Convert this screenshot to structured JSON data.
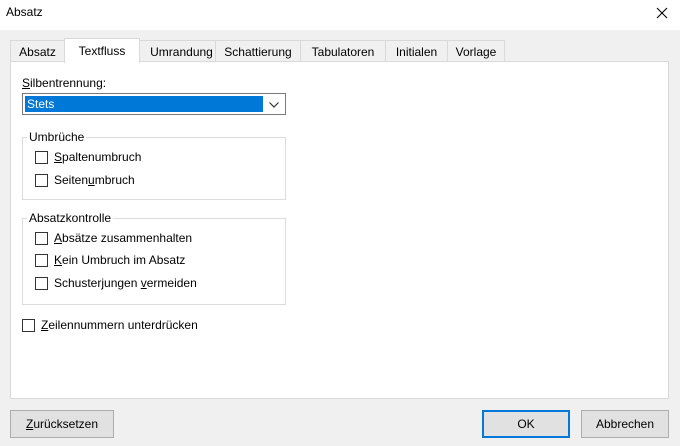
{
  "window": {
    "title": "Absatz",
    "close_icon": "close-icon"
  },
  "tabs": [
    {
      "label": "Absatz",
      "active": false
    },
    {
      "label": "Textfluss",
      "active": true
    },
    {
      "label": "Umrandung",
      "active": false
    },
    {
      "label": "Schattierung",
      "active": false
    },
    {
      "label": "Tabulatoren",
      "active": false
    },
    {
      "label": "Initialen",
      "active": false
    },
    {
      "label": "Vorlage",
      "active": false
    }
  ],
  "hyphenation": {
    "label_mnemonic": "S",
    "label_rest": "ilbentrennung:",
    "selected": "Stets",
    "dropdown_icon": "chevron-down-icon"
  },
  "breaks": {
    "title": "Umbrüche",
    "items": [
      {
        "pre": "",
        "mnemonic": "S",
        "post": "paltenumbruch",
        "checked": false
      },
      {
        "pre": "Seiten",
        "mnemonic": "u",
        "post": "mbruch",
        "checked": false
      }
    ]
  },
  "paragraph_control": {
    "title": "Absatzkontrolle",
    "items": [
      {
        "pre": "",
        "mnemonic": "A",
        "post": "bsätze zusammenhalten",
        "checked": false
      },
      {
        "pre": "",
        "mnemonic": "K",
        "post": "ein Umbruch im Absatz",
        "checked": false
      },
      {
        "pre": "Schusterjungen ",
        "mnemonic": "v",
        "post": "ermeiden",
        "checked": false
      }
    ]
  },
  "suppress_line_numbers": {
    "pre": "",
    "mnemonic": "Z",
    "post": "eilennummern unterdrücken",
    "checked": false
  },
  "buttons": {
    "reset_mnemonic": "Z",
    "reset_rest": "urücksetzen",
    "ok": "OK",
    "cancel": "Abbrechen"
  },
  "colors": {
    "selection": "#0078d7",
    "default_button_border": "#0078d7"
  }
}
